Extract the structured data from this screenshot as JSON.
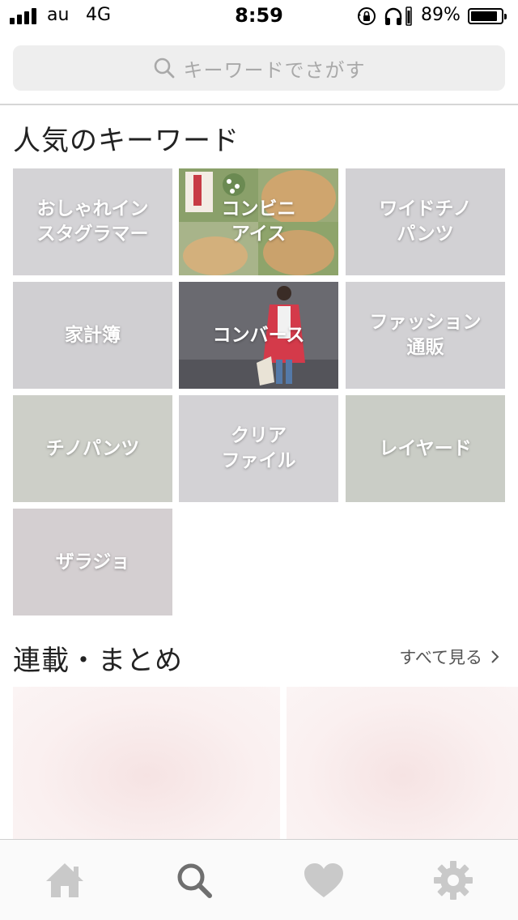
{
  "status_bar": {
    "carrier": "au",
    "network": "4G",
    "time": "8:59",
    "battery_percent": "89%",
    "battery_level": 0.89,
    "signal_bars": 4
  },
  "search": {
    "placeholder": "キーワードでさがす",
    "icon": "search-icon"
  },
  "popular_keywords": {
    "title": "人気のキーワード",
    "items": [
      {
        "label": "おしゃれイン\nスタグラマー",
        "bg": "#d4d3d6"
      },
      {
        "label": "コンビニ\nアイス",
        "bg": "#c9b58d"
      },
      {
        "label": "ワイドチノ\nパンツ",
        "bg": "#d2d1d4"
      },
      {
        "label": "家計簿",
        "bg": "#d0cfd2"
      },
      {
        "label": "コンバース",
        "bg": "#5e5e66"
      },
      {
        "label": "ファッション\n通販",
        "bg": "#d2d1d4"
      },
      {
        "label": "チノパンツ",
        "bg": "#cdcfc8"
      },
      {
        "label": "クリア\nファイル",
        "bg": "#d3d2d5"
      },
      {
        "label": "レイヤード",
        "bg": "#cacdc6"
      },
      {
        "label": "ザラジョ",
        "bg": "#d4cfd1"
      }
    ]
  },
  "series": {
    "title": "連載・まとめ",
    "see_all_label": "すべて見る"
  },
  "tab_bar": {
    "tabs": [
      {
        "icon": "home-icon",
        "active": false
      },
      {
        "icon": "search-icon",
        "active": true
      },
      {
        "icon": "heart-icon",
        "active": false
      },
      {
        "icon": "gear-icon",
        "active": false
      }
    ],
    "active_color": "#6f6f6f",
    "inactive_color": "#c9c9c9"
  }
}
